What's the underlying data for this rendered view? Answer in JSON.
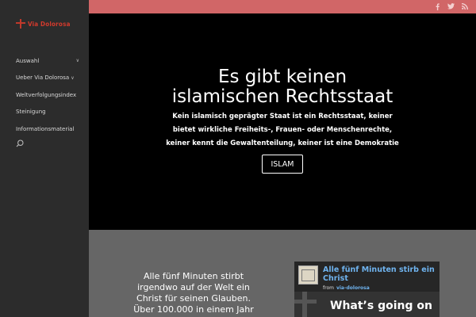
{
  "brand": {
    "logo_text": "Via Dolorosa"
  },
  "sidebar": {
    "items": [
      {
        "label": "Auswahl",
        "arrow": "∨"
      },
      {
        "label": "Ueber Via Dolorosa",
        "arrow": "∨"
      },
      {
        "label": "Weltverfolgungsindex"
      },
      {
        "label": "Steinigung"
      },
      {
        "label": "Informationsmaterial"
      }
    ],
    "search_icon": "search-icon"
  },
  "topbar": {
    "social": [
      "facebook-icon",
      "twitter-icon",
      "rss-icon"
    ]
  },
  "hero": {
    "title_line1": "Es gibt keinen",
    "title_line2": "islamischen Rechtsstaat",
    "sub_line1": "Kein islamisch geprägter Staat  ist ein Rechtsstaat, keiner",
    "sub_line2": "bietet wirkliche Freiheits-, Frauen- oder Menschenrechte,",
    "sub_line3": "keiner kennt die Gewaltenteilung, keiner ist eine Demokratie",
    "button_label": "ISLAM"
  },
  "section2": {
    "quote_line1": "Alle fünf Minuten stirbt",
    "quote_line2": "irgendwo auf der Welt ein",
    "quote_line3": "Christ für seinen Glauben.",
    "quote_line4": "Über 100.000 in einem Jahr",
    "widget": {
      "title": "Alle fünf Minuten stirb ein Christ",
      "from_label": "from",
      "from_user": "via-dolorosa",
      "headline": "What’s going on"
    }
  },
  "colors": {
    "topbar": "#d16667",
    "sidebar": "#2c2c2c",
    "hero_bg": "#000000",
    "section_bg": "#666666",
    "widget_link": "#6fb3ee",
    "logo_red": "#d33a2c"
  }
}
